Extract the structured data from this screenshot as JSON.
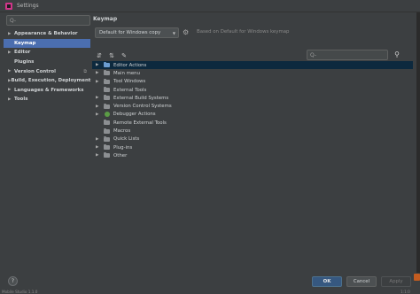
{
  "window": {
    "title": "Settings"
  },
  "left": {
    "search_placeholder": "Q-",
    "tree": [
      {
        "label": "Appearance & Behavior",
        "expandable": true,
        "sub": false,
        "selected": false
      },
      {
        "label": "Keymap",
        "expandable": false,
        "sub": true,
        "selected": true
      },
      {
        "label": "Editor",
        "expandable": true,
        "sub": false,
        "selected": false
      },
      {
        "label": "Plugins",
        "expandable": false,
        "sub": true,
        "selected": false
      },
      {
        "label": "Version Control",
        "expandable": true,
        "sub": false,
        "selected": false
      },
      {
        "label": "Build, Execution, Deployment",
        "expandable": true,
        "sub": false,
        "selected": false
      },
      {
        "label": "Languages & Frameworks",
        "expandable": true,
        "sub": false,
        "selected": false
      },
      {
        "label": "Tools",
        "expandable": true,
        "sub": false,
        "selected": false
      }
    ]
  },
  "keymap": {
    "title": "Keymap",
    "selected_keymap": "Default for Windows copy",
    "based_on": "Based on Default for Windows keymap",
    "search_placeholder": "Q-",
    "actions": [
      {
        "label": "Editor Actions",
        "icon": "folder-blue",
        "expandable": true,
        "selected": true
      },
      {
        "label": "Main menu",
        "icon": "folder",
        "expandable": true,
        "selected": false
      },
      {
        "label": "Tool Windows",
        "icon": "folder",
        "expandable": true,
        "selected": false
      },
      {
        "label": "External Tools",
        "icon": "folder",
        "expandable": false,
        "selected": false
      },
      {
        "label": "External Build Systems",
        "icon": "folder",
        "expandable": true,
        "selected": false
      },
      {
        "label": "Version Control Systems",
        "icon": "folder",
        "expandable": true,
        "selected": false
      },
      {
        "label": "Debugger Actions",
        "icon": "bug",
        "expandable": true,
        "selected": false
      },
      {
        "label": "Remote External Tools",
        "icon": "folder",
        "expandable": false,
        "selected": false
      },
      {
        "label": "Macros",
        "icon": "folder",
        "expandable": false,
        "selected": false
      },
      {
        "label": "Quick Lists",
        "icon": "folder",
        "expandable": true,
        "selected": false
      },
      {
        "label": "Plug-ins",
        "icon": "folder",
        "expandable": true,
        "selected": false
      },
      {
        "label": "Other",
        "icon": "folder",
        "expandable": true,
        "selected": false
      }
    ]
  },
  "buttons": {
    "help": "?",
    "ok": "OK",
    "cancel": "Cancel",
    "apply": "Apply"
  },
  "status": {
    "left": "Mobile Studio 1.1.0",
    "right": "1:1:0"
  },
  "colors": {
    "accent": "#4b6eaf",
    "ok_button": "#365880",
    "selected_row": "#0d293e"
  }
}
